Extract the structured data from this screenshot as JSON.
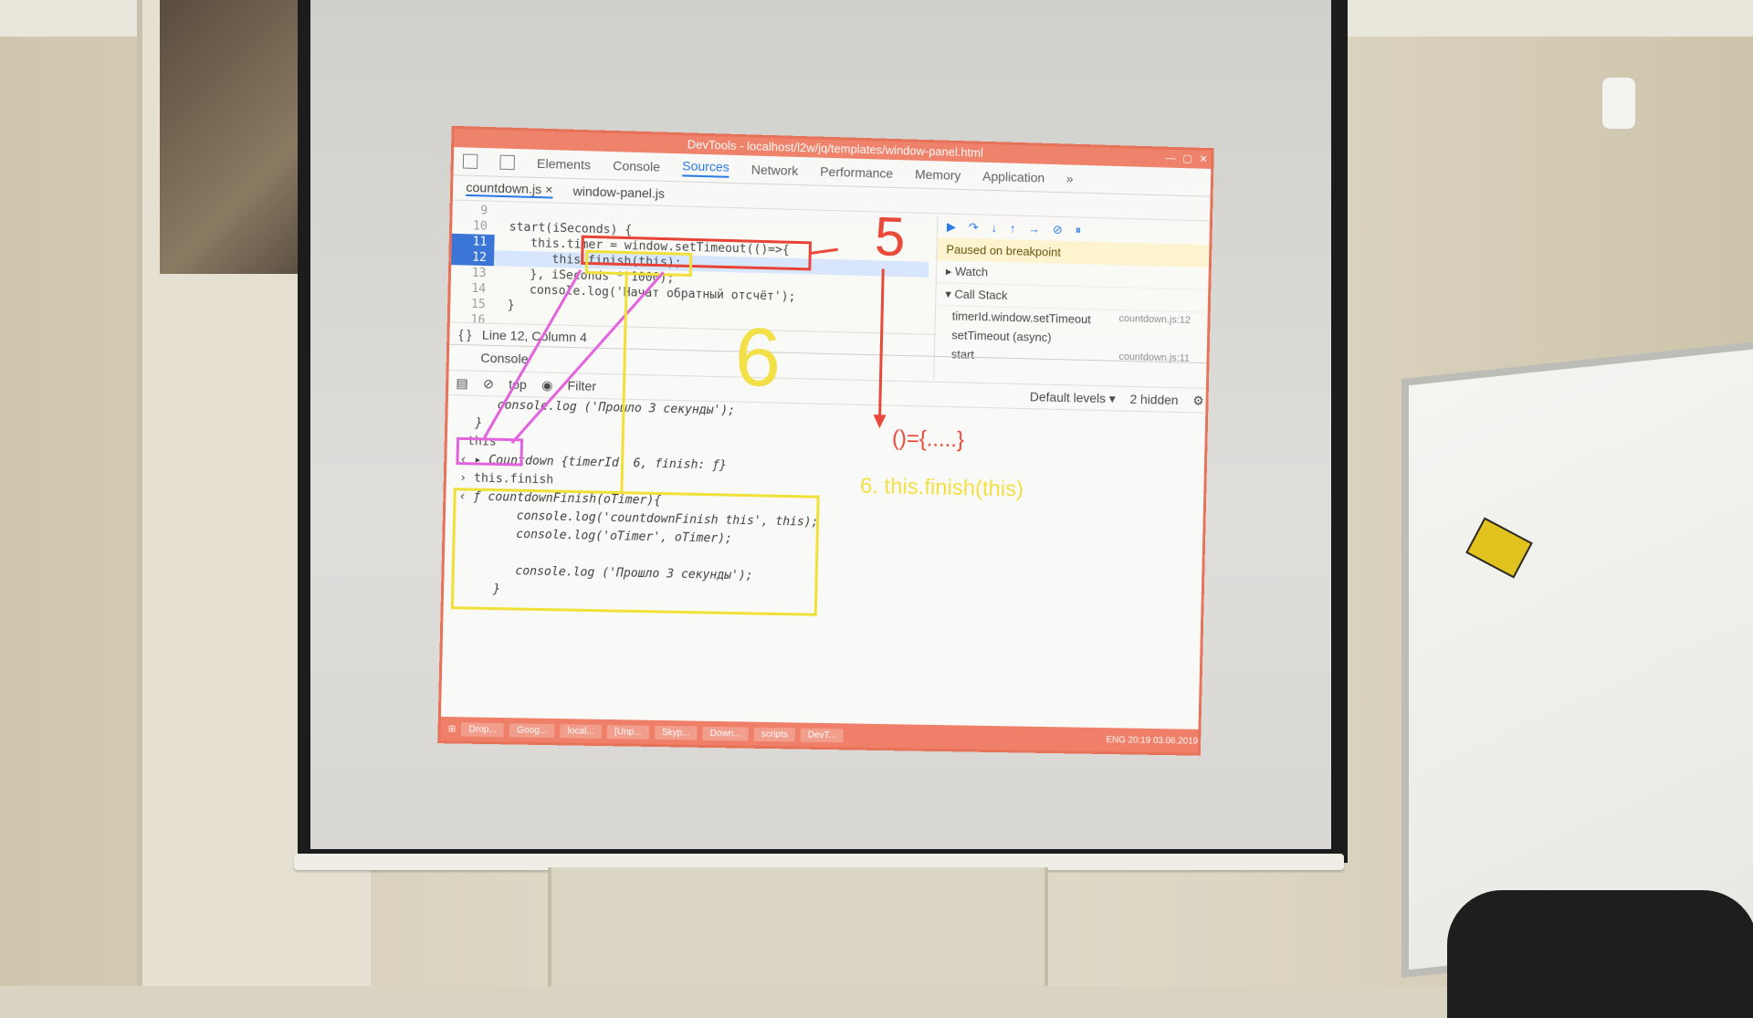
{
  "devtools": {
    "title": "DevTools - localhost/l2w/jq/templates/window-panel.html",
    "tabs": [
      "Elements",
      "Console",
      "Sources",
      "Network",
      "Performance",
      "Memory",
      "Application",
      "»"
    ],
    "file_tabs": [
      "countdown.js ×",
      "window-panel.js"
    ],
    "editor": {
      "lines": [
        {
          "num": "9",
          "text": ""
        },
        {
          "num": "10",
          "text": "  start(iSeconds) {"
        },
        {
          "num": "11",
          "text": "     this.timer = window.setTimeout(()=>{"
        },
        {
          "num": "12",
          "text": "        this.finish(this);"
        },
        {
          "num": "13",
          "text": "     }, iSeconds * 1000);"
        },
        {
          "num": "14",
          "text": "     console.log('Начат обратный отсчёт');"
        },
        {
          "num": "15",
          "text": "  }"
        },
        {
          "num": "16",
          "text": ""
        }
      ],
      "status": "Line 12, Column 4"
    },
    "debugger": {
      "banner": "Paused on breakpoint",
      "watch": "▸ Watch",
      "call_stack": "▾ Call Stack",
      "stack": [
        {
          "fn": "timerId.window.setTimeout",
          "loc": "countdown.js:12"
        },
        {
          "fn": "setTimeout (async)",
          "loc": ""
        },
        {
          "fn": "start",
          "loc": "countdown.js:11"
        }
      ]
    },
    "drawer_tab": "Console",
    "console_bar": {
      "context": "top",
      "filter": "Filter",
      "levels": "Default levels ▾",
      "hidden": "2 hidden"
    },
    "console_lines": [
      "     console.log ('Прошло 3 секунды');",
      "  }",
      " this",
      "‹ ▸ Countdown {timerId: 6, finish: ƒ}",
      "› this.finish",
      "‹ ƒ countdownFinish(oTimer){",
      "        console.log('countdownFinish this', this);",
      "        console.log('oTimer', oTimer);",
      "",
      "        console.log ('Прошло 3 секунды');",
      "     }"
    ],
    "taskbar": [
      "Drop...",
      "Goog...",
      "local...",
      "[Unp...",
      "Skyp...",
      "Down...",
      "scripts",
      "DevT..."
    ],
    "tray": "ENG  20:19  03.06.2019"
  },
  "annotations": {
    "red_arrow_text": "()={.....}",
    "yellow_text": "6. this.finish(this)",
    "yellow_number": "6",
    "red_number": "5"
  }
}
